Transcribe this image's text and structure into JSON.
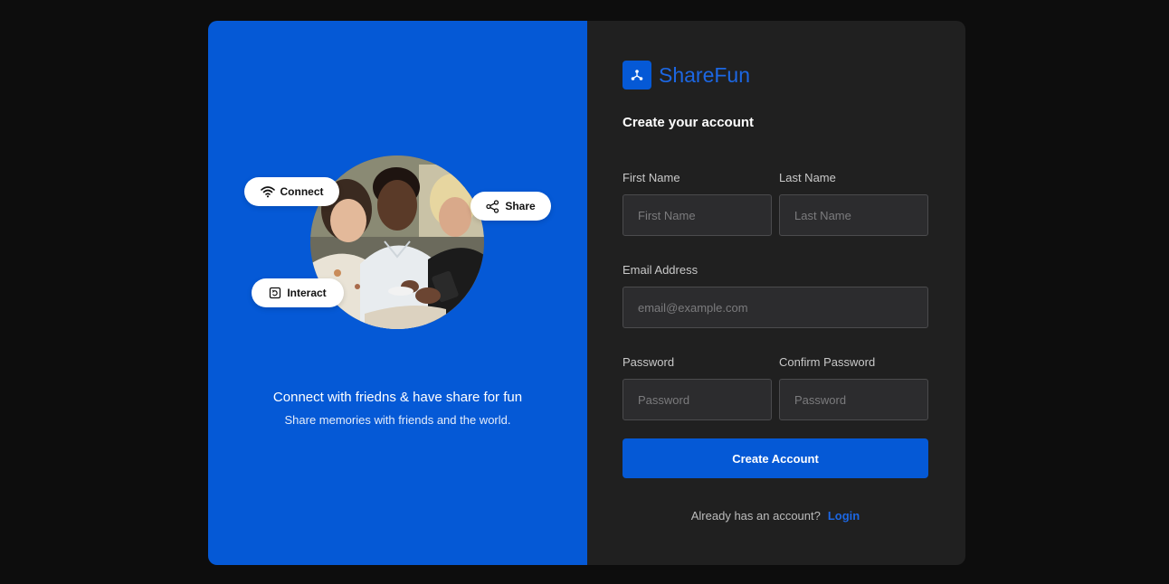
{
  "colors": {
    "page_bg": "#0d0d0d",
    "brand_blue": "#0559d6",
    "panel_dark": "#202020",
    "input_bg": "#2c2c2e",
    "link_blue": "#1c67e3"
  },
  "hero": {
    "pills": {
      "connect": {
        "label": "Connect",
        "icon": "wifi-icon"
      },
      "share": {
        "label": "Share",
        "icon": "share-icon"
      },
      "interact": {
        "label": "Interact",
        "icon": "interact-icon"
      }
    },
    "title": "Connect with friedns & have share for fun",
    "subtitle": "Share memories with friends and the world."
  },
  "brand": {
    "name": "ShareFun",
    "icon": "sharefun-logo-icon"
  },
  "form": {
    "title": "Create your account",
    "first_name": {
      "label": "First Name",
      "placeholder": "First Name"
    },
    "last_name": {
      "label": "Last Name",
      "placeholder": "Last Name"
    },
    "email": {
      "label": "Email Address",
      "placeholder": "email@example.com"
    },
    "password": {
      "label": "Password",
      "placeholder": "Password"
    },
    "confirm_password": {
      "label": "Confirm Password",
      "placeholder": "Password"
    },
    "submit_label": "Create Account",
    "login_prompt": "Already has an account?",
    "login_link": "Login"
  }
}
